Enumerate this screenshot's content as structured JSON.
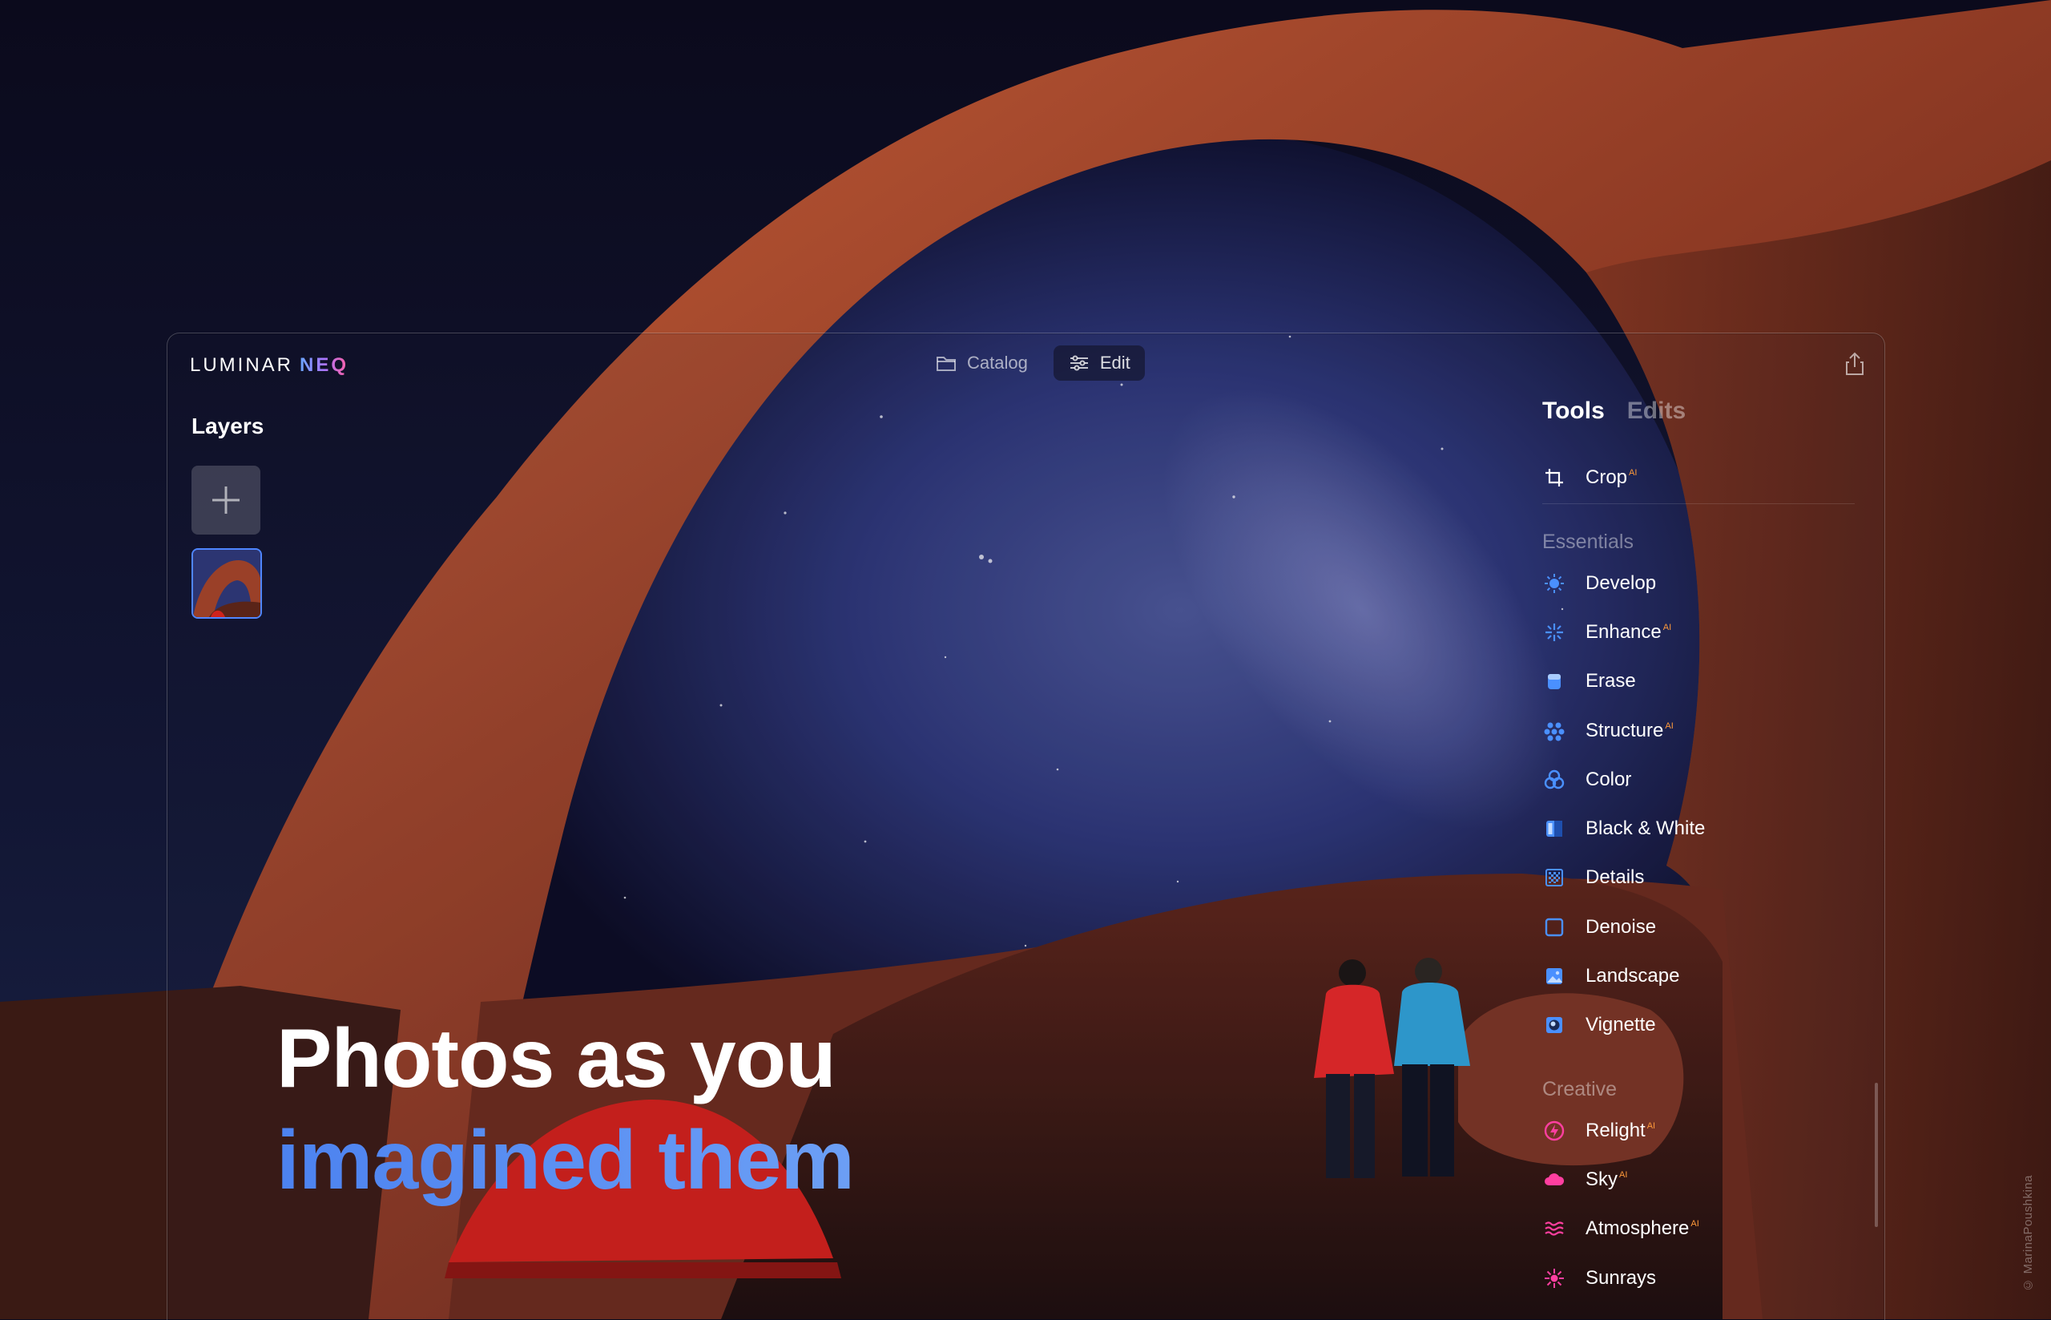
{
  "brand": {
    "name": "LUMINAR",
    "suffix": "NEQ"
  },
  "modes": [
    {
      "label": "Catalog",
      "icon": "folder-icon",
      "active": false
    },
    {
      "label": "Edit",
      "icon": "sliders-icon",
      "active": true
    }
  ],
  "layers": {
    "title": "Layers"
  },
  "panel": {
    "tabs": [
      {
        "label": "Tools",
        "active": true
      },
      {
        "label": "Edits",
        "active": false
      }
    ],
    "crop": {
      "label": "Crop",
      "ai": "AI",
      "icon": "crop-icon"
    },
    "sections": [
      {
        "title": "Essentials",
        "tools": [
          {
            "label": "Develop",
            "ai": "",
            "icon": "sun-icon",
            "color": "#4a90ff"
          },
          {
            "label": "Enhance",
            "ai": "AI",
            "icon": "sparkle-icon",
            "color": "#4a90ff"
          },
          {
            "label": "Erase",
            "ai": "",
            "icon": "eraser-icon",
            "color": "#4a90ff"
          },
          {
            "label": "Structure",
            "ai": "AI",
            "icon": "dots-icon",
            "color": "#4a90ff"
          },
          {
            "label": "Color",
            "ai": "",
            "icon": "color-circles-icon",
            "color": "#4a90ff"
          },
          {
            "label": "Black & White",
            "ai": "",
            "icon": "half-square-icon",
            "color": "#4a90ff"
          },
          {
            "label": "Details",
            "ai": "",
            "icon": "grid-icon",
            "color": "#4a90ff"
          },
          {
            "label": "Denoise",
            "ai": "",
            "icon": "square-icon",
            "color": "#4a90ff"
          },
          {
            "label": "Landscape",
            "ai": "",
            "icon": "picture-icon",
            "color": "#4a90ff"
          },
          {
            "label": "Vignette",
            "ai": "",
            "icon": "vignette-icon",
            "color": "#4a90ff"
          }
        ]
      },
      {
        "title": "Creative",
        "tools": [
          {
            "label": "Relight",
            "ai": "AI",
            "icon": "bolt-circle-icon",
            "color": "#ff3fa0"
          },
          {
            "label": "Sky",
            "ai": "AI",
            "icon": "cloud-icon",
            "color": "#ff3fa0"
          },
          {
            "label": "Atmosphere",
            "ai": "AI",
            "icon": "waves-icon",
            "color": "#ff3fa0"
          },
          {
            "label": "Sunrays",
            "ai": "",
            "icon": "sunrays-icon",
            "color": "#ff3fa0"
          }
        ]
      }
    ]
  },
  "headline": {
    "line1": "Photos as you",
    "line2": "imagined them"
  },
  "credit": "© MarinaPoushkina"
}
